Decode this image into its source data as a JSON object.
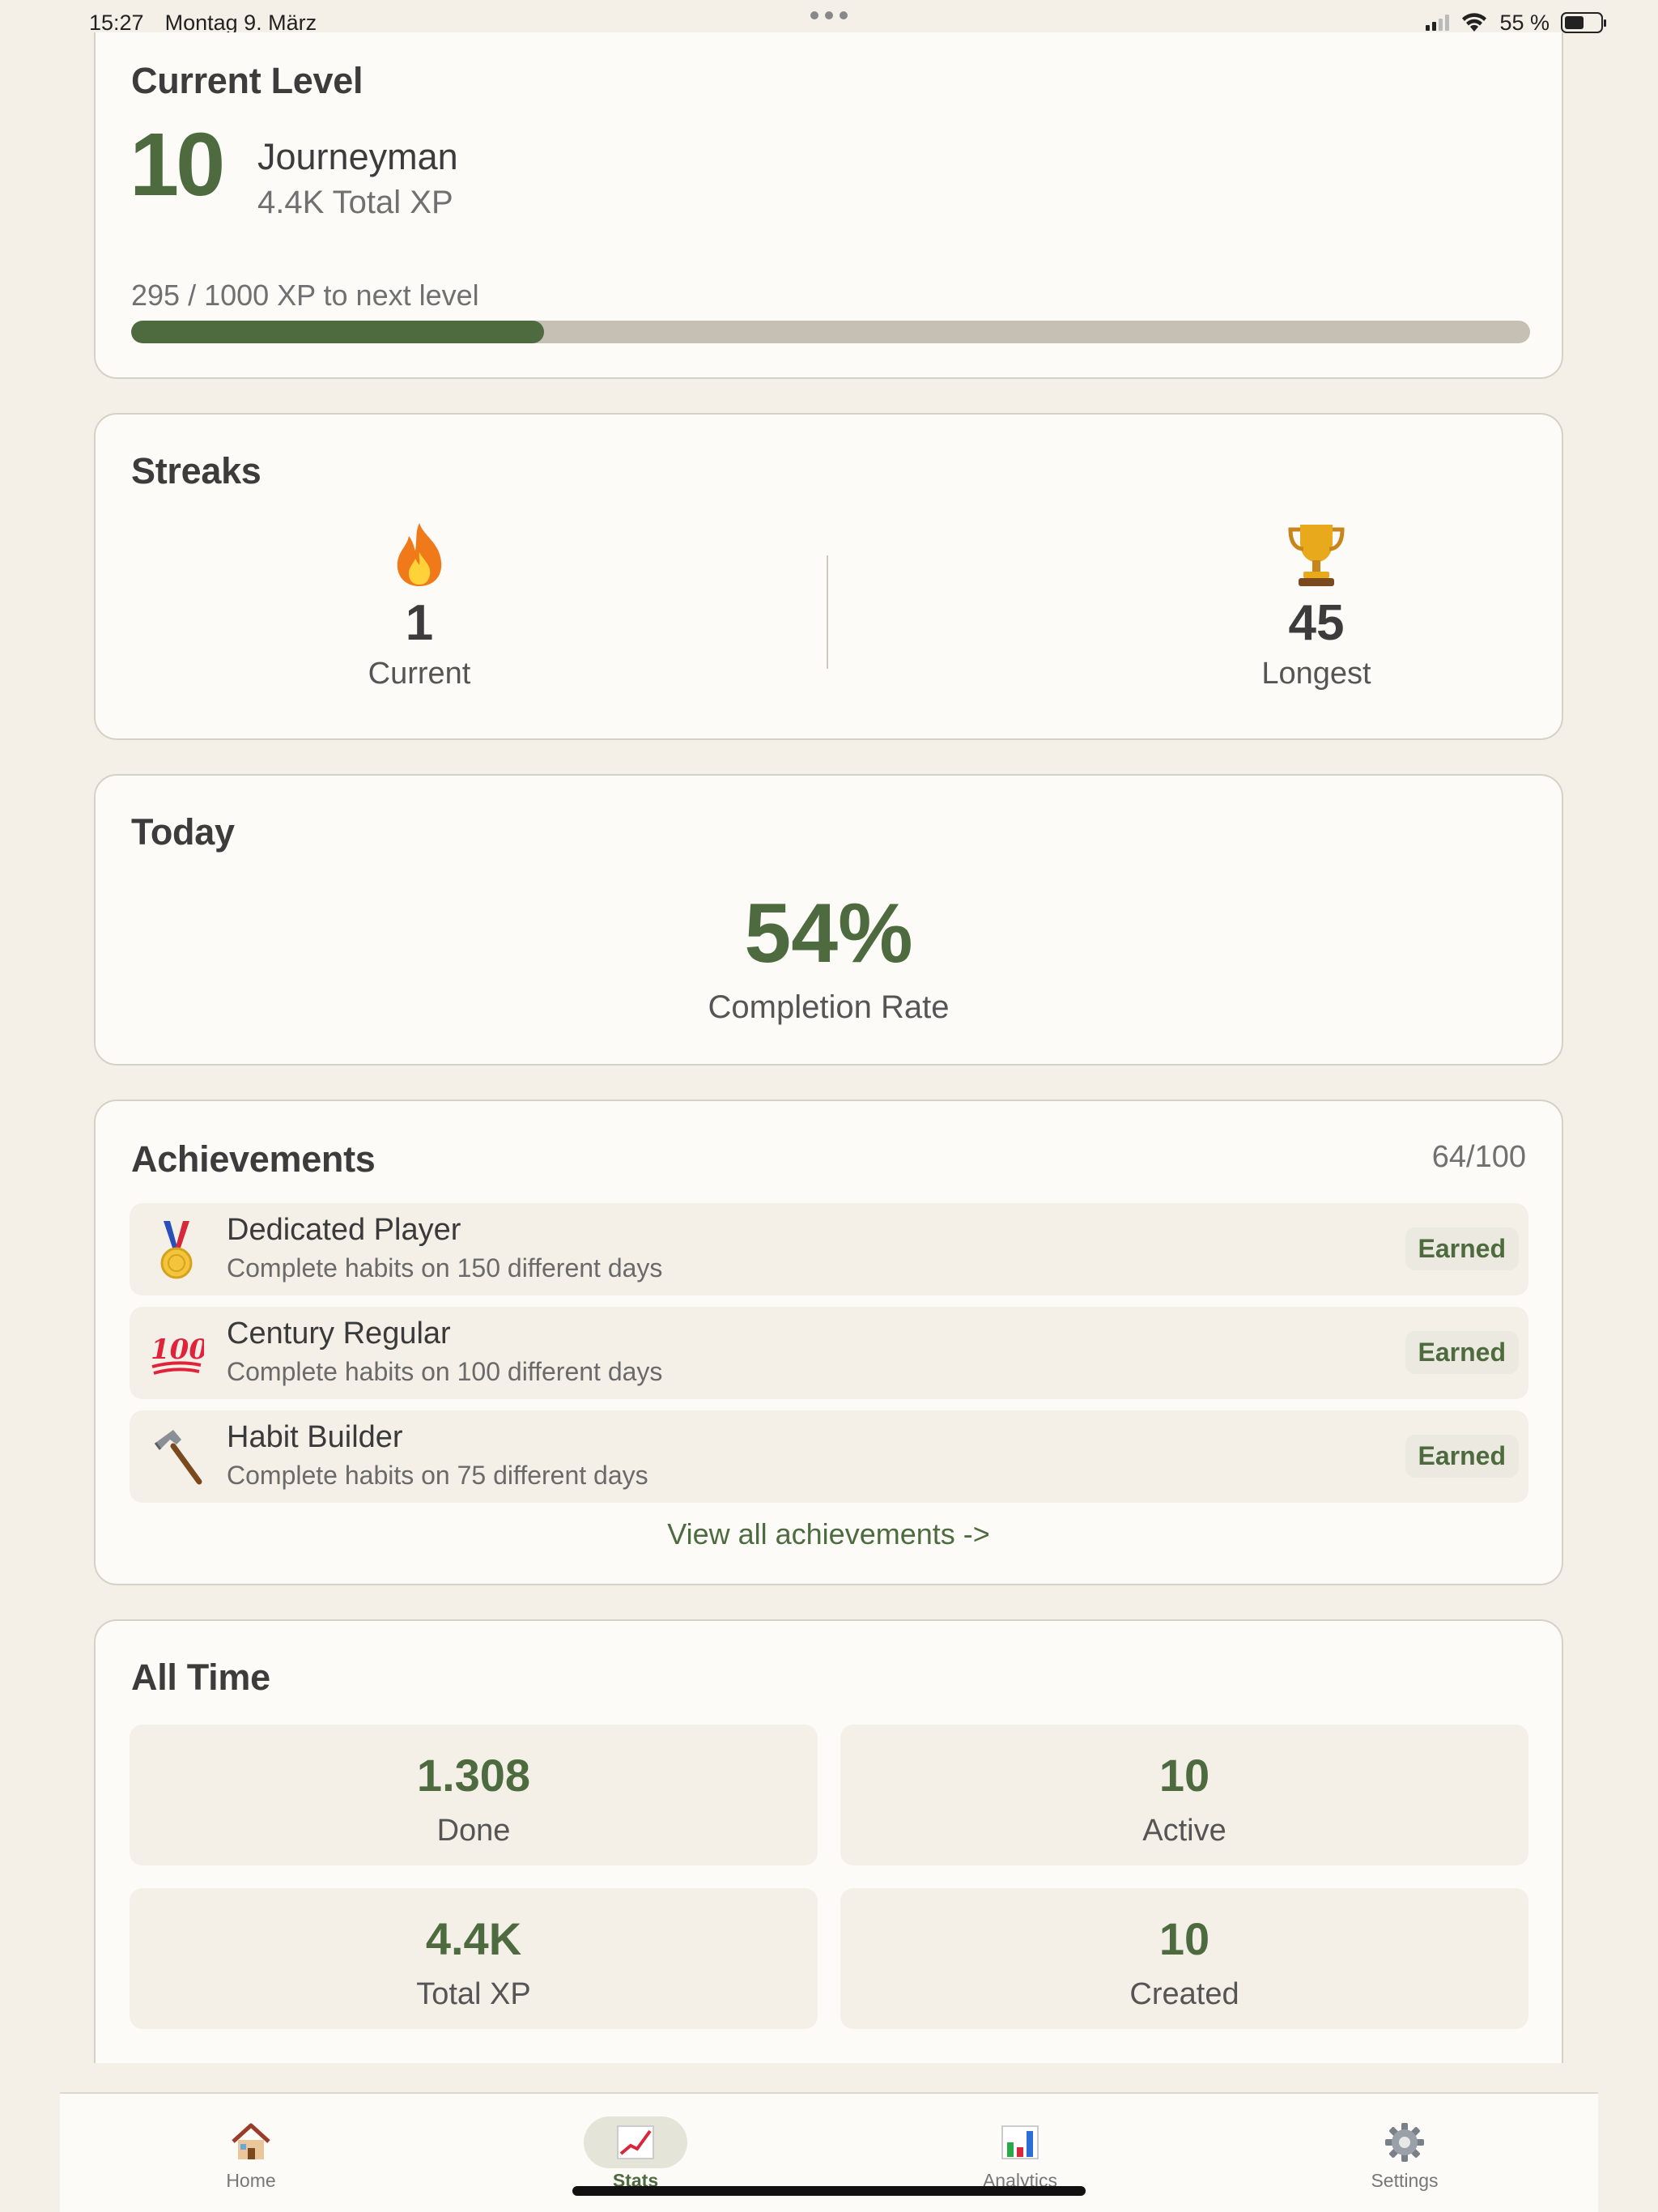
{
  "status_bar": {
    "time": "15:27",
    "date": "Montag 9. März",
    "battery": "55 %",
    "battery_level": 0.55,
    "signal_bars": 2
  },
  "level": {
    "title": "Current Level",
    "number": "10",
    "name": "Journeyman",
    "total_xp": "4.4K Total XP",
    "progress_label": "295 / 1000 XP to next level",
    "progress": 0.295,
    "accent_color": "#4d6b3f"
  },
  "streaks": {
    "title": "Streaks",
    "current": {
      "value": "1",
      "label": "Current",
      "icon": "fire-icon"
    },
    "longest": {
      "value": "45",
      "label": "Longest",
      "icon": "trophy-icon"
    }
  },
  "today": {
    "title": "Today",
    "value": "54%",
    "label": "Completion Rate"
  },
  "achievements": {
    "title": "Achievements",
    "count": "64/100",
    "items": [
      {
        "icon": "medal-icon",
        "name": "Dedicated Player",
        "description": "Complete habits on 150 different days",
        "badge": "Earned"
      },
      {
        "icon": "hundred-points-icon",
        "name": "Century Regular",
        "description": "Complete habits on 100 different days",
        "badge": "Earned"
      },
      {
        "icon": "hammer-icon",
        "name": "Habit Builder",
        "description": "Complete habits on 75 different days",
        "badge": "Earned"
      }
    ],
    "link": "View all achievements ->"
  },
  "all_time": {
    "title": "All Time",
    "stats": [
      {
        "value": "1.308",
        "label": "Done"
      },
      {
        "value": "10",
        "label": "Active"
      },
      {
        "value": "4.4K",
        "label": "Total XP"
      },
      {
        "value": "10",
        "label": "Created"
      }
    ]
  },
  "tabs": [
    {
      "label": "Home",
      "icon": "house-icon"
    },
    {
      "label": "Stats",
      "icon": "chart-line-icon",
      "active": true
    },
    {
      "label": "Analytics",
      "icon": "bar-chart-icon"
    },
    {
      "label": "Settings",
      "icon": "gear-icon"
    }
  ]
}
